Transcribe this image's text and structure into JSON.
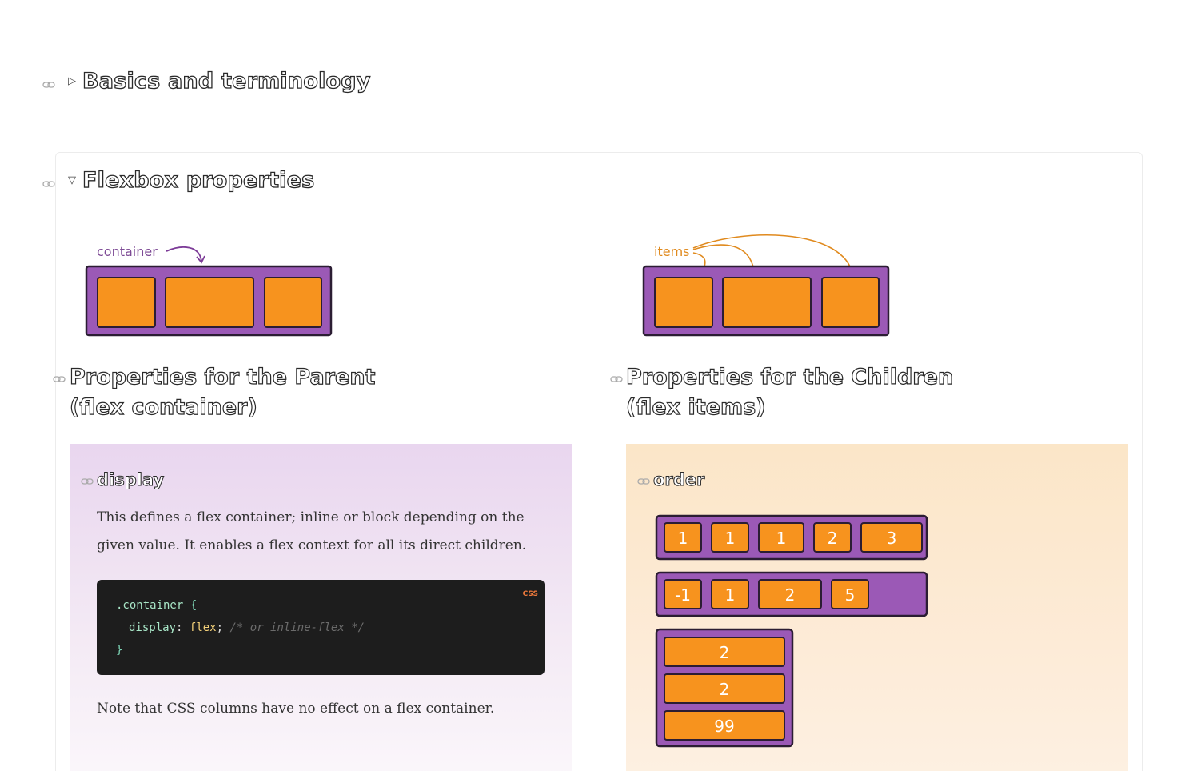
{
  "sections": [
    {
      "title": "Basics and terminology",
      "expanded": false
    },
    {
      "title": "Flexbox properties",
      "expanded": true
    }
  ],
  "illustrations": {
    "container_label": "container",
    "items_label": "items"
  },
  "parent": {
    "heading_line1": "Properties for the Parent",
    "heading_line2": "(flex container)",
    "property": {
      "name": "display",
      "description_line1": "This defines a flex container; inline or block depending on the",
      "description_line2": "given value. It enables a flex context for all its direct children.",
      "code_lang": "CSS",
      "code": {
        "selector": ".container",
        "open_brace": "{",
        "prop": "display",
        "colon": ":",
        "value": "flex",
        "semicolon": ";",
        "comment": "/* or inline-flex */",
        "close_brace": "}"
      },
      "note": "Note that CSS columns have no effect on a flex container."
    }
  },
  "children": {
    "heading_line1": "Properties for the Children",
    "heading_line2": "(flex items)",
    "property": {
      "name": "order",
      "row1": [
        "1",
        "1",
        "1",
        "2",
        "3"
      ],
      "row2": [
        "-1",
        "1",
        "2",
        "5"
      ],
      "column": [
        "2",
        "2",
        "99"
      ]
    }
  },
  "colors": {
    "purple": "#9b59b6",
    "orange": "#f7931e",
    "parent_panel": "#e9d6ef",
    "children_panel": "#fbe6c8",
    "code_bg": "#1d1d1d"
  }
}
